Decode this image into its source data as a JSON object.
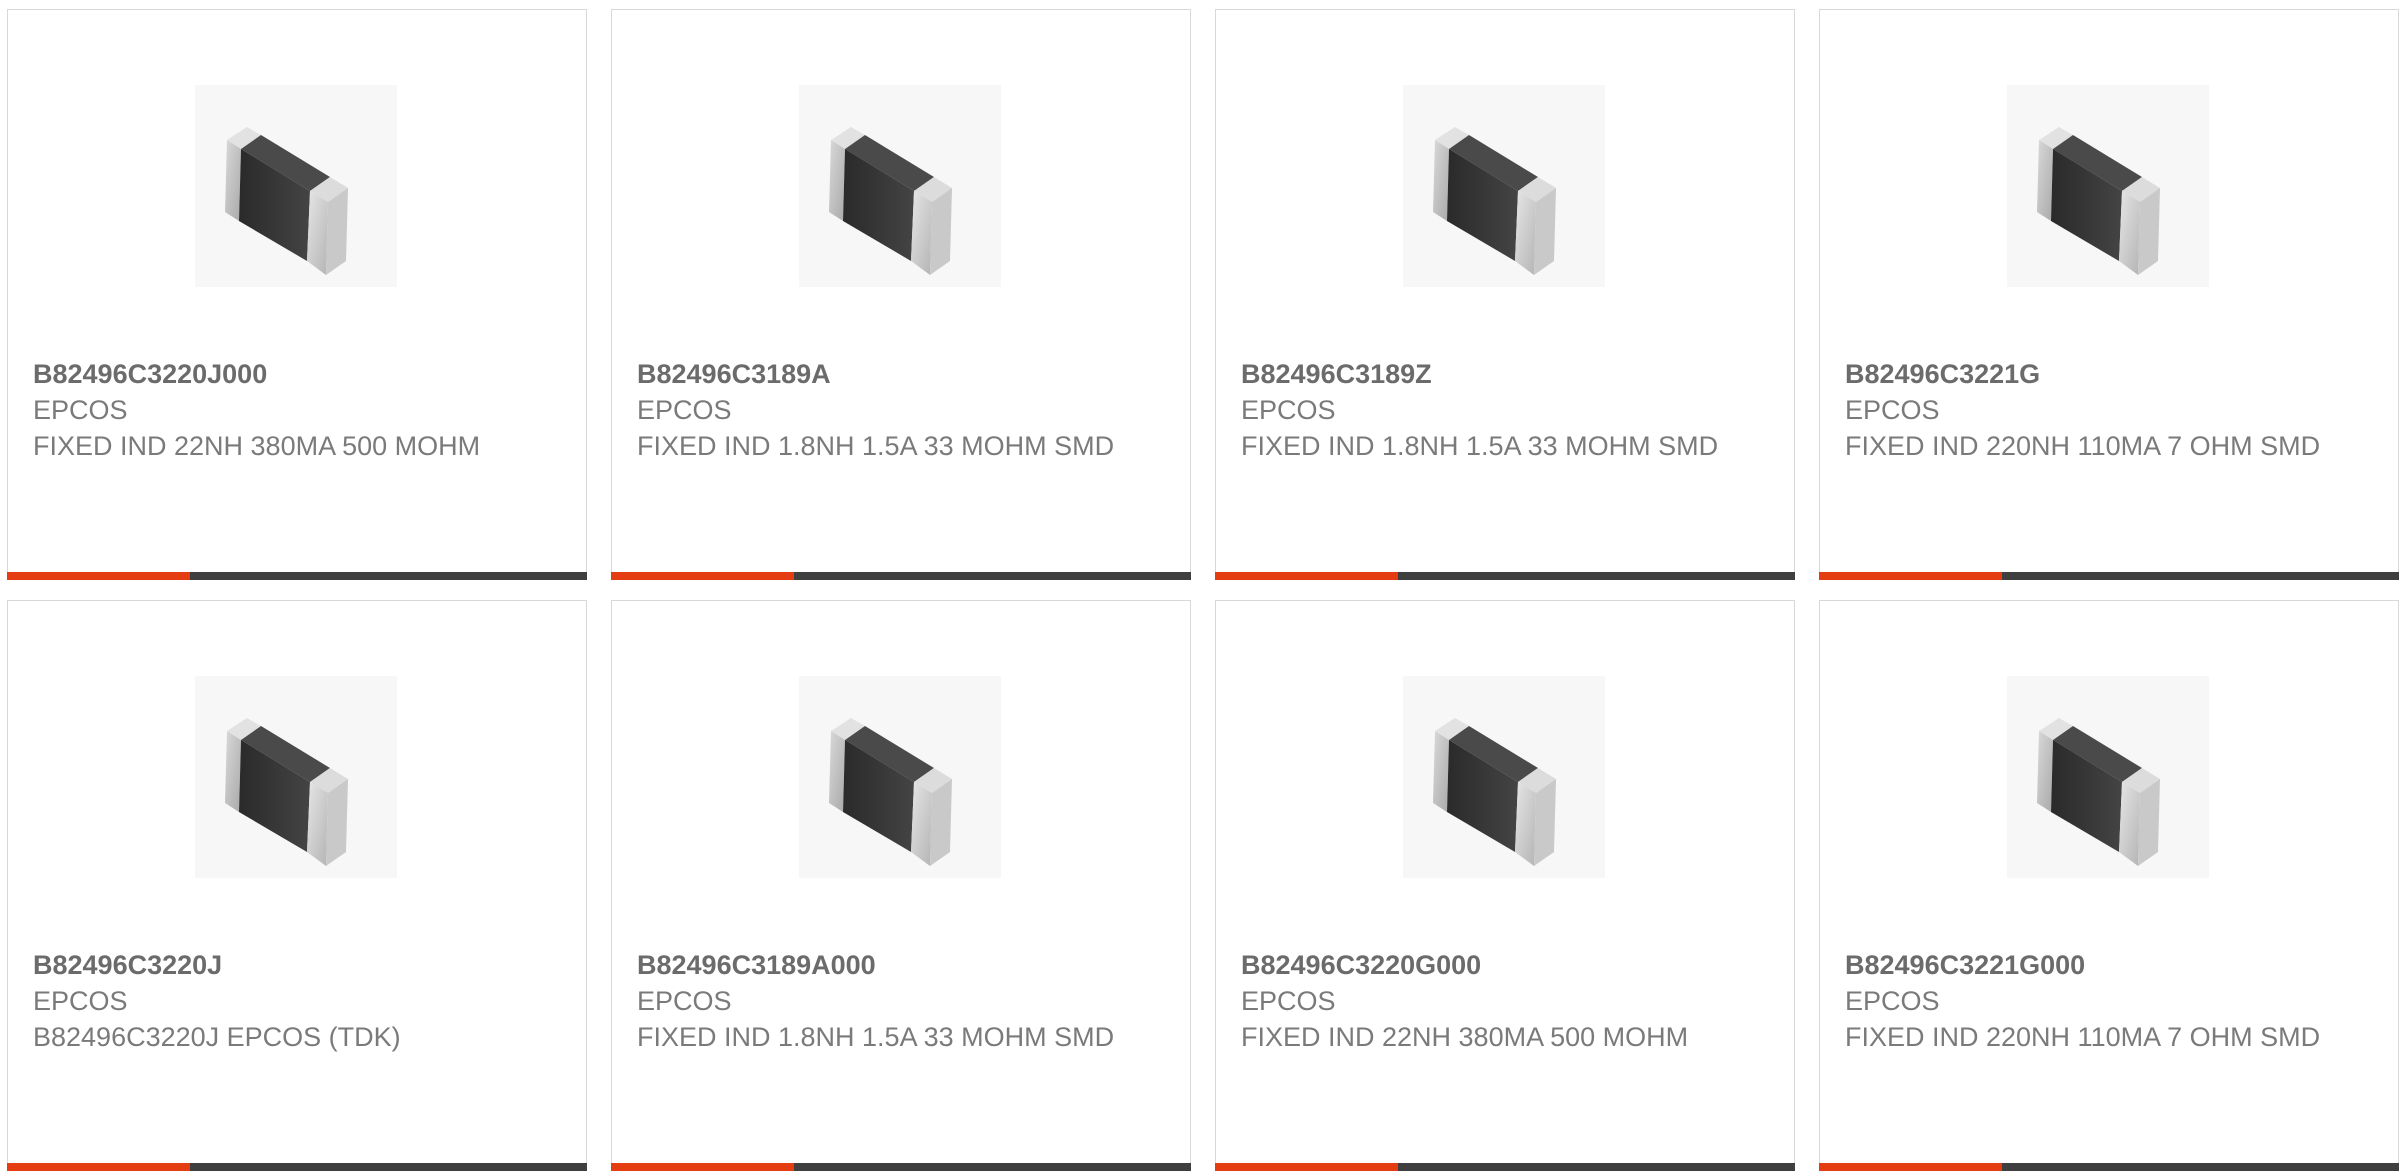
{
  "colors": {
    "accent": "#e43d12",
    "bar_dark": "#3f3f3f",
    "text": "#7a7a7a",
    "border": "#d8d8d8"
  },
  "products": [
    {
      "part_number": "B82496C3220J000",
      "manufacturer": "EPCOS",
      "description": "FIXED IND 22NH 380MA 500 MOHM",
      "image_icon": "smd-inductor-image"
    },
    {
      "part_number": "B82496C3189A",
      "manufacturer": "EPCOS",
      "description": "FIXED IND 1.8NH 1.5A 33 MOHM SMD",
      "image_icon": "smd-inductor-image"
    },
    {
      "part_number": "B82496C3189Z",
      "manufacturer": "EPCOS",
      "description": "FIXED IND 1.8NH 1.5A 33 MOHM SMD",
      "image_icon": "smd-inductor-image"
    },
    {
      "part_number": "B82496C3221G",
      "manufacturer": "EPCOS",
      "description": "FIXED IND 220NH 110MA 7 OHM SMD",
      "image_icon": "smd-inductor-image"
    },
    {
      "part_number": "B82496C3220J",
      "manufacturer": "EPCOS",
      "description": "B82496C3220J EPCOS (TDK)",
      "image_icon": "smd-inductor-image"
    },
    {
      "part_number": "B82496C3189A000",
      "manufacturer": "EPCOS",
      "description": "FIXED IND 1.8NH 1.5A 33 MOHM SMD",
      "image_icon": "smd-inductor-image"
    },
    {
      "part_number": "B82496C3220G000",
      "manufacturer": "EPCOS",
      "description": "FIXED IND 22NH 380MA 500 MOHM",
      "image_icon": "smd-inductor-image"
    },
    {
      "part_number": "B82496C3221G000",
      "manufacturer": "EPCOS",
      "description": "FIXED IND 220NH 110MA 7 OHM SMD",
      "image_icon": "smd-inductor-image"
    }
  ]
}
